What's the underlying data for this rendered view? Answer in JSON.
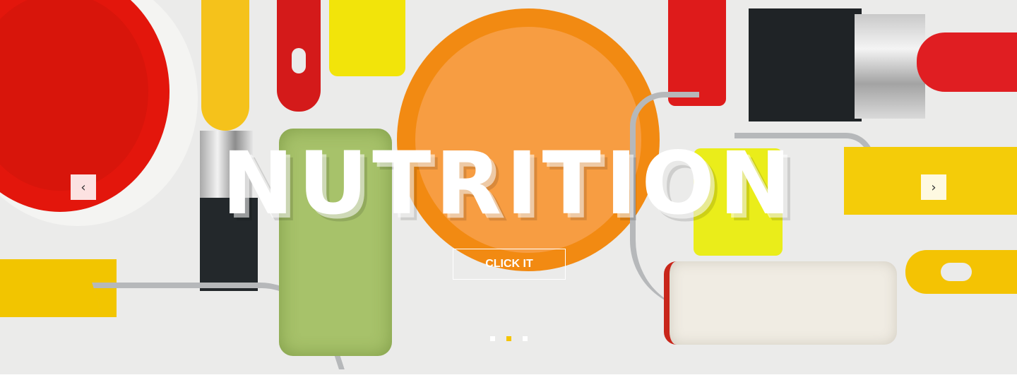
{
  "slider": {
    "headline": "NUTRITION",
    "cta_label": "CLICK IT",
    "prev_icon": "chevron-left-icon",
    "next_icon": "chevron-right-icon",
    "prev_glyph": "‹",
    "next_glyph": "›",
    "slide_count": 3,
    "active_slide": 2,
    "colors": {
      "accent": "#f5c400",
      "cta_border": "#ffffff",
      "headline": "#ffffff"
    }
  }
}
